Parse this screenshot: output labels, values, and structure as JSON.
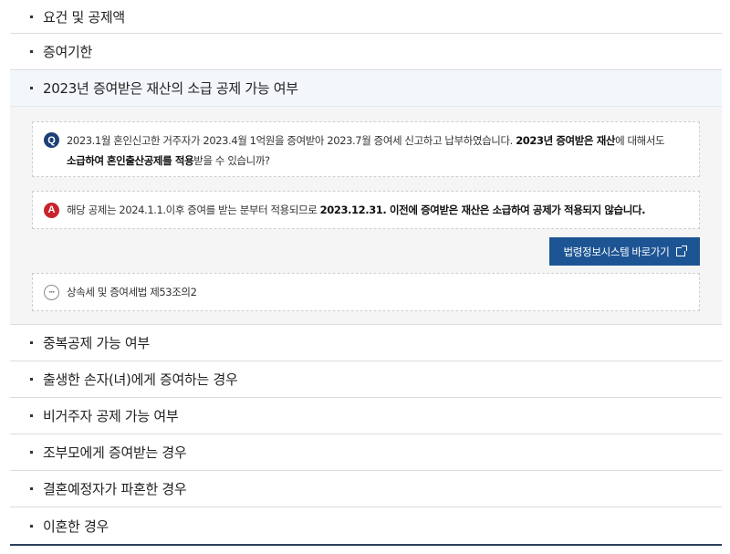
{
  "accordion": {
    "items_top": [
      {
        "label": "요건 및 공제액"
      },
      {
        "label": "증여기한"
      }
    ],
    "open_item": {
      "label": "2023년 증여받은 재산의 소급 공제 가능 여부"
    },
    "panel": {
      "q_badge": "Q",
      "q_line1_plain": "2023.1월 혼인신고한 거주자가 2023.4월 1억원을 증여받아 2023.7월 증여세 신고하고 납부하였습니다. ",
      "q_line1_bold": "2023년 증여받은 재산",
      "q_line1_end": "에 대해서도",
      "q_line2_bold1": "소급하여",
      "q_line2_sp": " ",
      "q_line2_bold2": "혼인출산공제",
      "q_line2_mid": "를 ",
      "q_line2_bold3": "적용",
      "q_line2_end": "받을 수 있습니까?",
      "a_badge": "A",
      "a_plain": "해당 공제는 2024.1.1.이후 증여를 받는 분부터 적용되므로 ",
      "a_bold": "2023.12.31. 이전에 증여받은 재산은 소급하여 공제가 적용되지 않습니다.",
      "law_button": "법령정보시스템 바로가기",
      "law_ref": "상속세 및 증여세법 제53조의2",
      "more_glyph": "···"
    },
    "items_bottom": [
      {
        "label": "중복공제 가능 여부"
      },
      {
        "label": "출생한 손자(녀)에게 증여하는 경우"
      },
      {
        "label": "비거주자 공제 가능 여부"
      },
      {
        "label": "조부모에게 증여받는 경우"
      },
      {
        "label": "결혼예정자가 파혼한 경우"
      },
      {
        "label": "이혼한 경우"
      }
    ]
  }
}
